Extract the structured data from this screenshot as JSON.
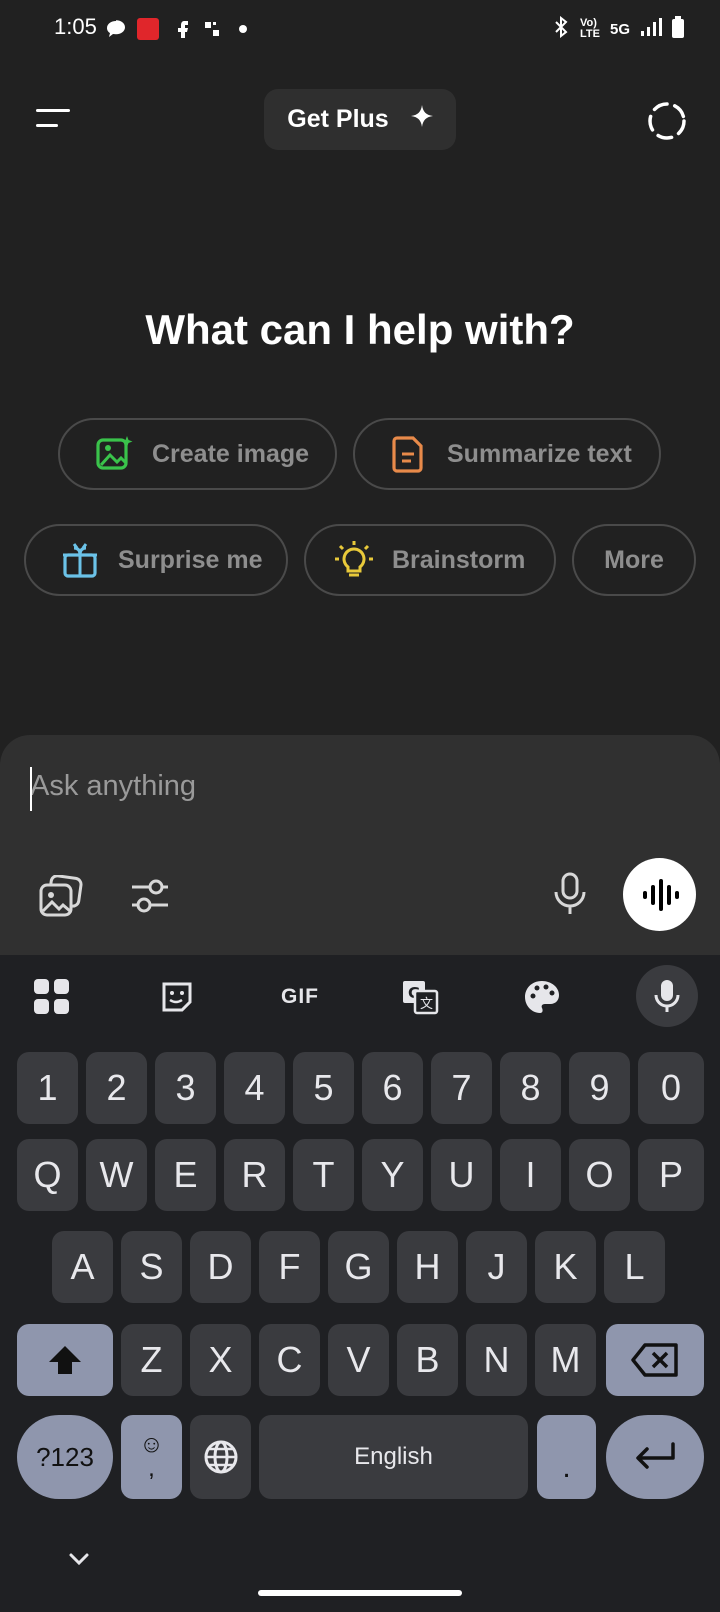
{
  "status_bar": {
    "time": "1:05",
    "network": "5G"
  },
  "header": {
    "get_plus_label": "Get Plus"
  },
  "main": {
    "headline": "What can I help with?",
    "suggestions": [
      {
        "label": "Create image",
        "icon": "image-sparkle-icon",
        "color": "#3ac34b"
      },
      {
        "label": "Summarize text",
        "icon": "document-icon",
        "color": "#e88a4a"
      },
      {
        "label": "Surprise me",
        "icon": "gift-icon",
        "color": "#6bc2e8"
      },
      {
        "label": "Brainstorm",
        "icon": "lightbulb-icon",
        "color": "#e8c93a"
      },
      {
        "label": "More",
        "icon": "",
        "color": ""
      }
    ]
  },
  "composer": {
    "placeholder": "Ask anything"
  },
  "keyboard": {
    "toolbar": [
      "apps-icon",
      "sticker-icon",
      "gif-icon",
      "translate-icon",
      "palette-icon",
      "mic-icon"
    ],
    "gif_label": "GIF",
    "row_numbers": [
      "1",
      "2",
      "3",
      "4",
      "5",
      "6",
      "7",
      "8",
      "9",
      "0"
    ],
    "row_q": [
      "Q",
      "W",
      "E",
      "R",
      "T",
      "Y",
      "U",
      "I",
      "O",
      "P"
    ],
    "row_a": [
      "A",
      "S",
      "D",
      "F",
      "G",
      "H",
      "J",
      "K",
      "L"
    ],
    "row_z": [
      "Z",
      "X",
      "C",
      "V",
      "B",
      "N",
      "M"
    ],
    "symbols_label": "?123",
    "comma_label": ",",
    "space_label": "English",
    "period_label": "."
  }
}
